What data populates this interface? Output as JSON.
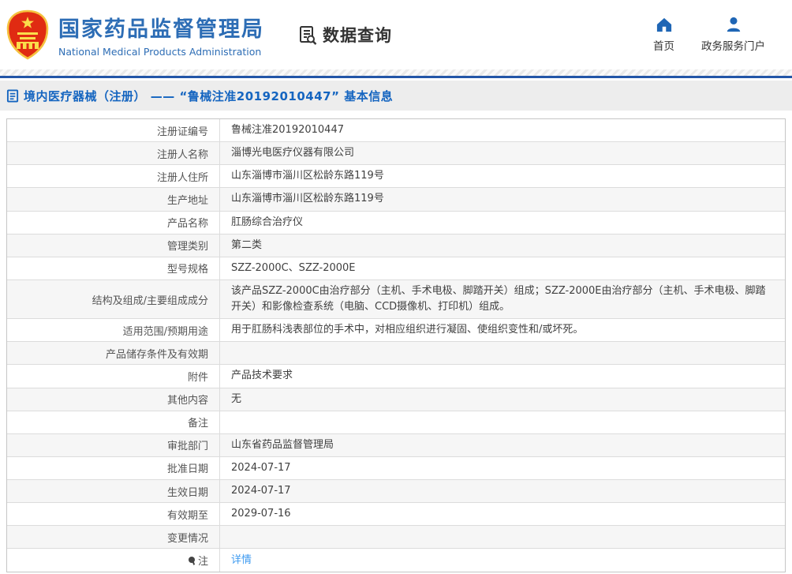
{
  "header": {
    "org_name_cn": "国家药品监督管理局",
    "org_name_en": "National Medical Products Administration",
    "data_query_label": "数据查询",
    "nav": [
      {
        "label": "首页",
        "icon": "home-icon"
      },
      {
        "label": "政务服务门户",
        "icon": "user-icon"
      }
    ]
  },
  "breadcrumb": {
    "title": "境内医疗器械（注册） —— “鲁械注准20192010447” 基本信息"
  },
  "colors": {
    "brand_blue": "#2d6db5",
    "divider_blue": "#2356a7",
    "breadcrumb_text": "#1565c0",
    "link_blue": "#3d9af0",
    "row_alt_bg": "#f6f6f6",
    "emblem_red": "#e02b12",
    "emblem_gold": "#f5c13e"
  },
  "table": {
    "rows": [
      {
        "label": "注册证编号",
        "value": "鲁械注准20192010447"
      },
      {
        "label": "注册人名称",
        "value": "淄博光电医疗仪器有限公司"
      },
      {
        "label": "注册人住所",
        "value": "山东淄博市淄川区松龄东路119号"
      },
      {
        "label": "生产地址",
        "value": "山东淄博市淄川区松龄东路119号"
      },
      {
        "label": "产品名称",
        "value": "肛肠综合治疗仪"
      },
      {
        "label": "管理类别",
        "value": "第二类"
      },
      {
        "label": "型号规格",
        "value": "SZZ-2000C、SZZ-2000E"
      },
      {
        "label": "结构及组成/主要组成成分",
        "value": "该产品SZZ-2000C由治疗部分（主机、手术电极、脚踏开关）组成；SZZ-2000E由治疗部分（主机、手术电极、脚踏开关）和影像检查系统（电脑、CCD摄像机、打印机）组成。"
      },
      {
        "label": "适用范围/预期用途",
        "value": "用于肛肠科浅表部位的手术中，对相应组织进行凝固、使组织变性和/或坏死。"
      },
      {
        "label": "产品储存条件及有效期",
        "value": ""
      },
      {
        "label": "附件",
        "value": "产品技术要求"
      },
      {
        "label": "其他内容",
        "value": "无"
      },
      {
        "label": "备注",
        "value": ""
      },
      {
        "label": "审批部门",
        "value": "山东省药品监督管理局"
      },
      {
        "label": "批准日期",
        "value": "2024-07-17"
      },
      {
        "label": "生效日期",
        "value": "2024-07-17"
      },
      {
        "label": "有效期至",
        "value": "2029-07-16"
      },
      {
        "label": "变更情况",
        "value": ""
      },
      {
        "label": "注",
        "value": "详情"
      }
    ]
  }
}
